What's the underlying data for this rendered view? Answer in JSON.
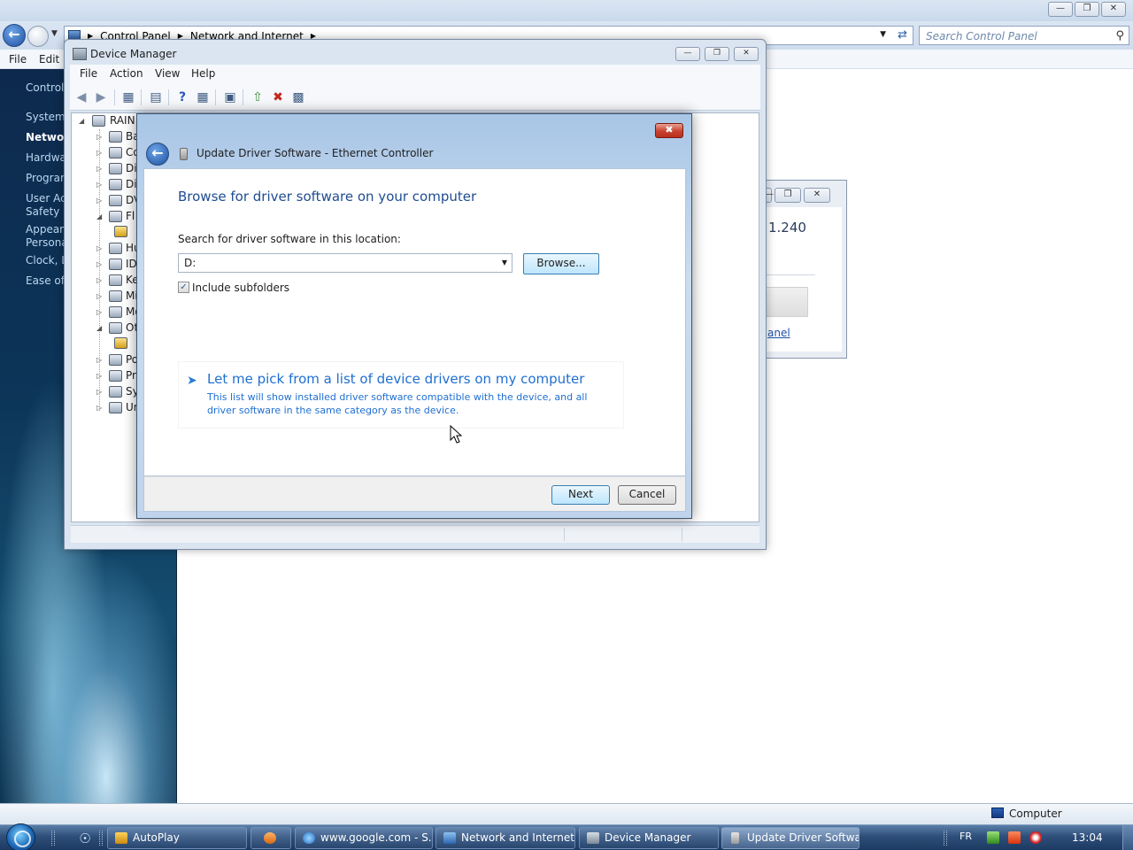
{
  "control_panel": {
    "breadcrumb": [
      "Control Panel",
      "Network and Internet"
    ],
    "search_placeholder": "Search Control Panel",
    "menu": {
      "file": "File",
      "edit": "Edit"
    },
    "sidebar_links": [
      "Control",
      "System",
      "Network",
      "Hardwa",
      "Program",
      "User Ac",
      "Safety",
      "Appeara",
      "Persona",
      "Clock, L",
      "Ease of"
    ],
    "status_computer": "Computer"
  },
  "system_window": {
    "value_fragment": "1.240",
    "link_fragment": "anel"
  },
  "device_manager": {
    "title": "Device Manager",
    "menu": {
      "file": "File",
      "action": "Action",
      "view": "View",
      "help": "Help"
    },
    "tree_root": "RAIN",
    "tree_items": [
      "Ba",
      "Co",
      "Di",
      "Di",
      "DV",
      "Fl",
      "Hu",
      "ID",
      "Ke",
      "Mi",
      "Mo",
      "Ot",
      "Po",
      "Pr",
      "Sy",
      "Un"
    ]
  },
  "update_driver": {
    "title": "Update Driver Software - Ethernet Controller",
    "heading": "Browse for driver software on your computer",
    "location_label": "Search for driver software in this location:",
    "location_value": "D:",
    "browse_label": "Browse...",
    "include_subfolders_label": "Include subfolders",
    "include_subfolders_checked": true,
    "pick_title": "Let me pick from a list of device drivers on my computer",
    "pick_description": "This list will show installed driver software compatible with the device, and all driver software in the same category as the device.",
    "next_label": "Next",
    "cancel_label": "Cancel"
  },
  "taskbar": {
    "buttons": [
      {
        "label": "AutoPlay",
        "active": false
      },
      {
        "label": "www.google.com - S...",
        "active": false
      },
      {
        "label": "Network and Internet",
        "active": false
      },
      {
        "label": "Device Manager",
        "active": false
      },
      {
        "label": "Update Driver Softwa...",
        "active": true
      }
    ],
    "language": "FR",
    "clock": "13:04"
  },
  "colors": {
    "heading_blue": "#1f4c91",
    "link_blue": "#1f6fd1",
    "taskbar": "#2e4f7a",
    "close_red": "#c9412e"
  }
}
